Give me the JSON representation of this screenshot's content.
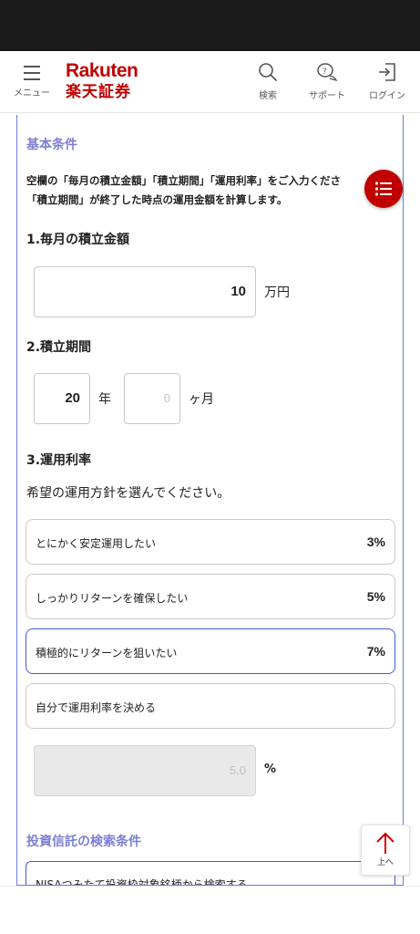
{
  "header": {
    "menu_label": "メニュー",
    "logo_en": "Rakuten",
    "logo_jp": "楽天証券",
    "search_label": "検索",
    "support_label": "サポート",
    "login_label": "ログイン"
  },
  "conditions": {
    "title": "基本条件",
    "desc_line1": "空欄の「毎月の積立金額」「積立期間」「運用利率」をご入力くださ",
    "desc_line2": "「積立期間」が終了した時点の運用金額を計算します。"
  },
  "monthly": {
    "title": "1.毎月の積立金額",
    "value": "10",
    "unit": "万円"
  },
  "period": {
    "title": "2.積立期間",
    "years_value": "20",
    "years_unit": "年",
    "months_placeholder": "0",
    "months_unit": "ヶ月"
  },
  "rate": {
    "title": "3.運用利率",
    "instruction": "希望の運用方針を選んでください。",
    "options": [
      {
        "label": "とにかく安定運用したい",
        "rate": "3%"
      },
      {
        "label": "しっかりリターンを確保したい",
        "rate": "5%"
      },
      {
        "label": "積極的にリターンを狙いたい",
        "rate": "7%"
      },
      {
        "label": "自分で運用利率を決める",
        "rate": ""
      }
    ],
    "selected_index": 2,
    "custom_placeholder": "5.0",
    "custom_unit": "%"
  },
  "fund_search": {
    "title": "投資信託の検索条件",
    "first_option": "NISAつみたて投資枠対象銘柄から検索する"
  },
  "to_top_label": "上へ",
  "colors": {
    "brand_red": "#bf0000",
    "section_title": "#7b7fd4",
    "selected_border": "#3f5bd1",
    "panel_border": "#6b7fd7"
  }
}
